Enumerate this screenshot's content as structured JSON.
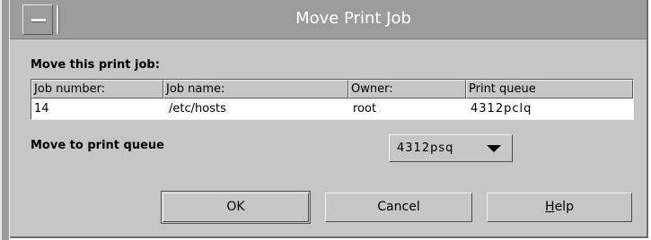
{
  "window": {
    "title": "Move Print Job"
  },
  "section": {
    "label": "Move this print job:"
  },
  "table": {
    "columns": [
      "Job number:",
      "Job name:",
      "Owner:",
      "Print queue"
    ],
    "rows": [
      [
        "14",
        "/etc/hosts",
        "root",
        "4312pclq"
      ]
    ]
  },
  "move_to": {
    "label": "Move to print queue",
    "selected_queue": "4312psq"
  },
  "buttons": {
    "ok": "OK",
    "cancel": "Cancel",
    "help_mnemonic": "H",
    "help_rest": "elp"
  },
  "icons": {
    "window_menu": "window-menu-icon",
    "dropdown": "dropdown-arrow-icon"
  },
  "colors": {
    "background": "#c6c6c6",
    "titlebar": "#9c9c9c",
    "title_text": "#ffffff",
    "table_background": "#ffffff"
  }
}
